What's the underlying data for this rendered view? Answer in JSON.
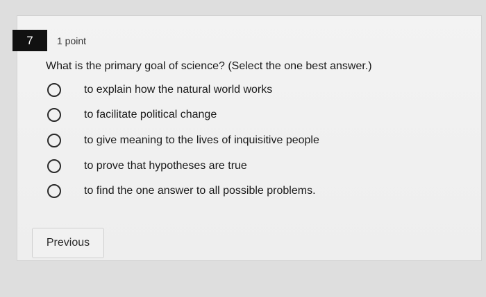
{
  "question": {
    "number": "7",
    "points": "1 point",
    "prompt": "What is the primary goal of science? (Select the one best answer.)",
    "options": [
      {
        "label": "to explain how the natural world works"
      },
      {
        "label": "to facilitate political change"
      },
      {
        "label": "to give meaning to the lives of inquisitive people"
      },
      {
        "label": "to prove that hypotheses are true"
      },
      {
        "label": "to find the one answer to all possible problems."
      }
    ]
  },
  "navigation": {
    "previous_label": "Previous"
  }
}
